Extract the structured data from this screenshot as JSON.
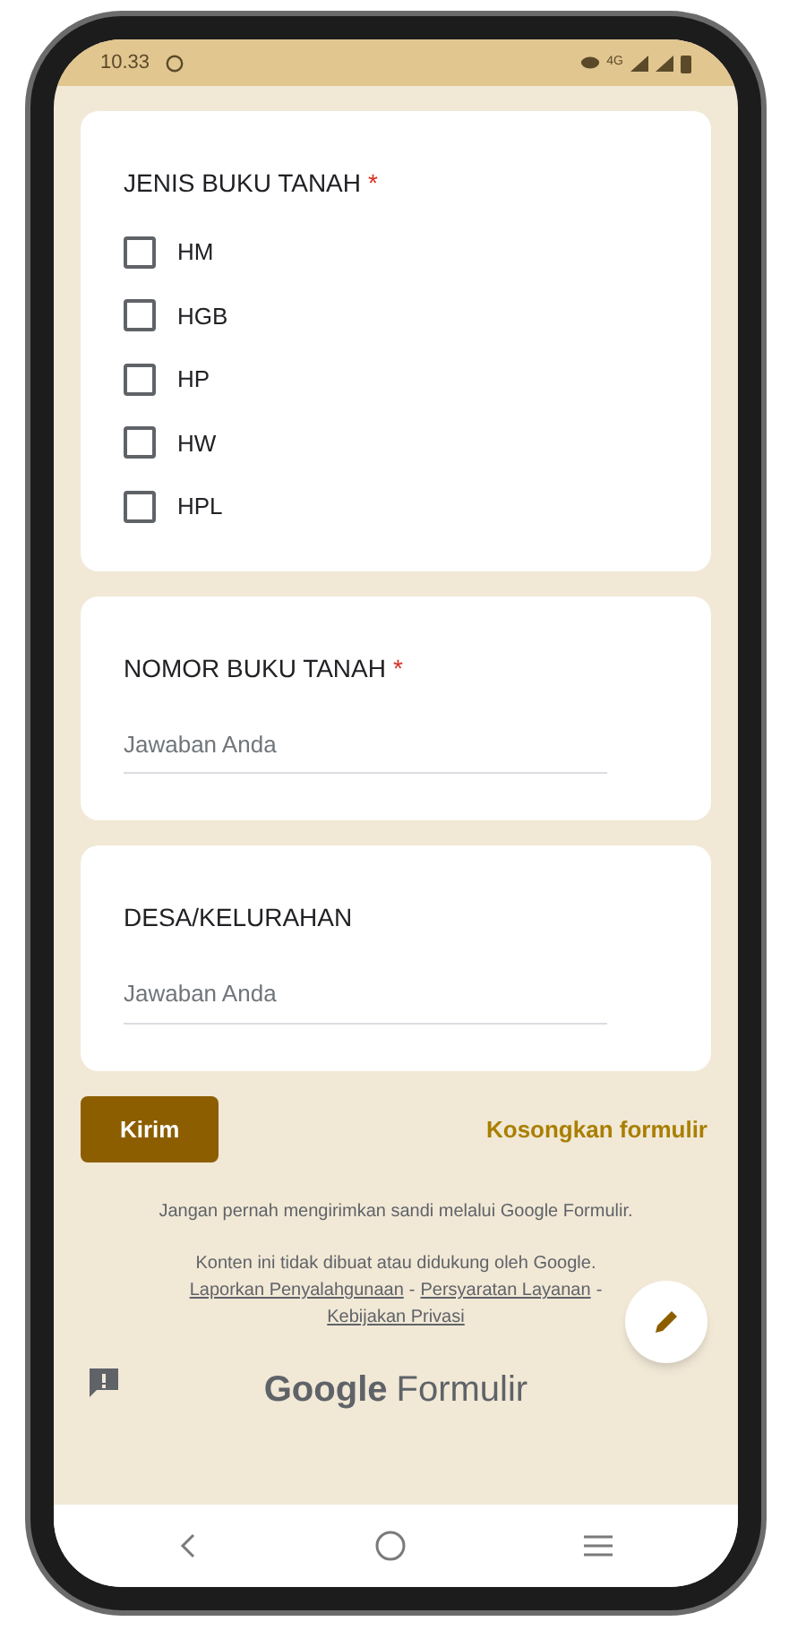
{
  "status_bar": {
    "time": "10.33",
    "network": "4G"
  },
  "questions": [
    {
      "kind": "checkboxes",
      "title": "JENIS BUKU TANAH",
      "required_mark": "*",
      "options": [
        {
          "label": "HM",
          "checked": false
        },
        {
          "label": "HGB",
          "checked": false
        },
        {
          "label": "HP",
          "checked": false
        },
        {
          "label": "HW",
          "checked": false
        },
        {
          "label": "HPL",
          "checked": false
        }
      ]
    },
    {
      "kind": "text",
      "title": "NOMOR BUKU TANAH",
      "required_mark": "*",
      "placeholder": "Jawaban Anda"
    },
    {
      "kind": "text",
      "title": "DESA/KELURAHAN",
      "placeholder": "Jawaban Anda"
    }
  ],
  "submit_button": "Kirim",
  "clear_button": "Kosongkan formulir",
  "warning": "Jangan pernah mengirimkan sandi melalui Google Formulir.",
  "disclaimer": "Konten ini tidak dibuat atau didukung oleh Google.",
  "footer_links": [
    {
      "kind": "link",
      "text": "Laporkan Penyalahgunaan"
    },
    {
      "kind": "separator",
      "text": "-"
    },
    {
      "kind": "link",
      "text": "Persyaratan Layanan"
    },
    {
      "kind": "separator",
      "text": "-"
    },
    {
      "kind": "link",
      "text": "Kebijakan Privasi"
    }
  ],
  "brand": {
    "primary": "Google",
    "secondary": "Formulir"
  }
}
